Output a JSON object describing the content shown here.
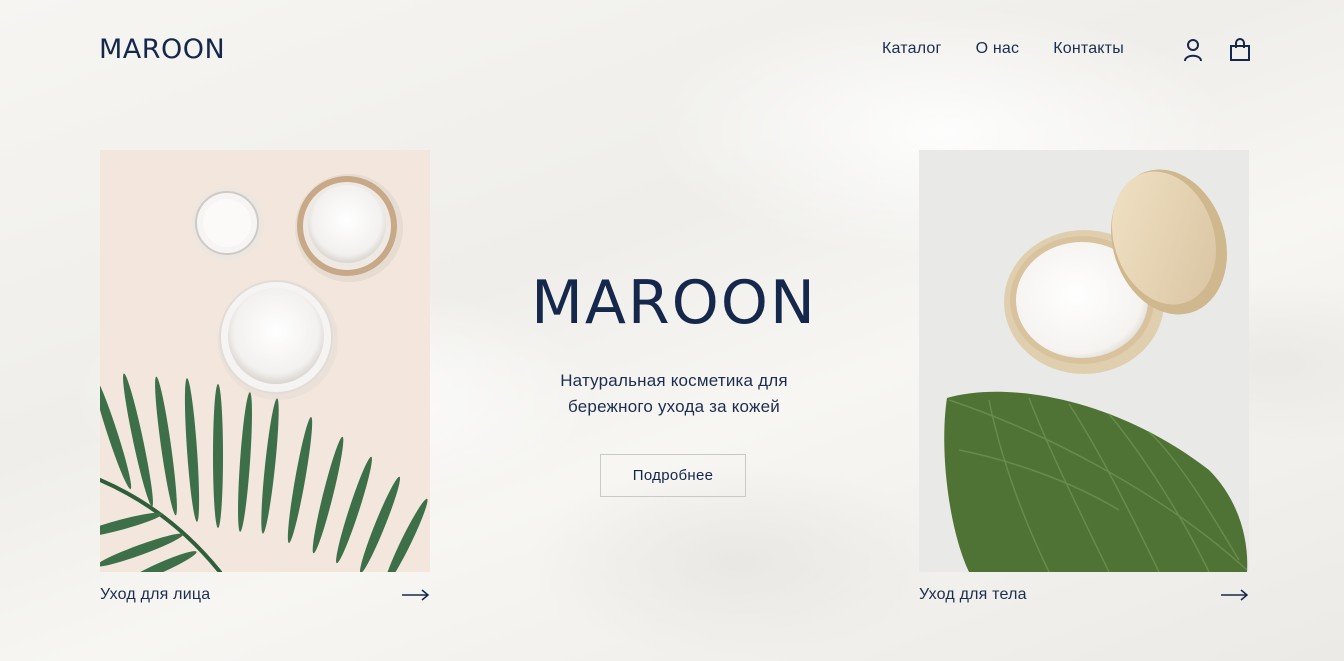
{
  "header": {
    "logo": "MAROON",
    "nav": [
      "Каталог",
      "О нас",
      "Контакты"
    ],
    "icons": [
      "user-icon",
      "shopping-bag-icon"
    ]
  },
  "hero": {
    "title": "MAROON",
    "subtitle_line1": "Натуральная косметика для",
    "subtitle_line2": "бережного ухода за кожей",
    "button_label": "Подробнее"
  },
  "cards": [
    {
      "label": "Уход для лица",
      "icon": "arrow-right-icon"
    },
    {
      "label": "Уход для тела",
      "icon": "arrow-right-icon"
    }
  ],
  "colors": {
    "primary": "#15284b",
    "background": "#f3f2ef",
    "button_border": "#c9c9c9"
  }
}
